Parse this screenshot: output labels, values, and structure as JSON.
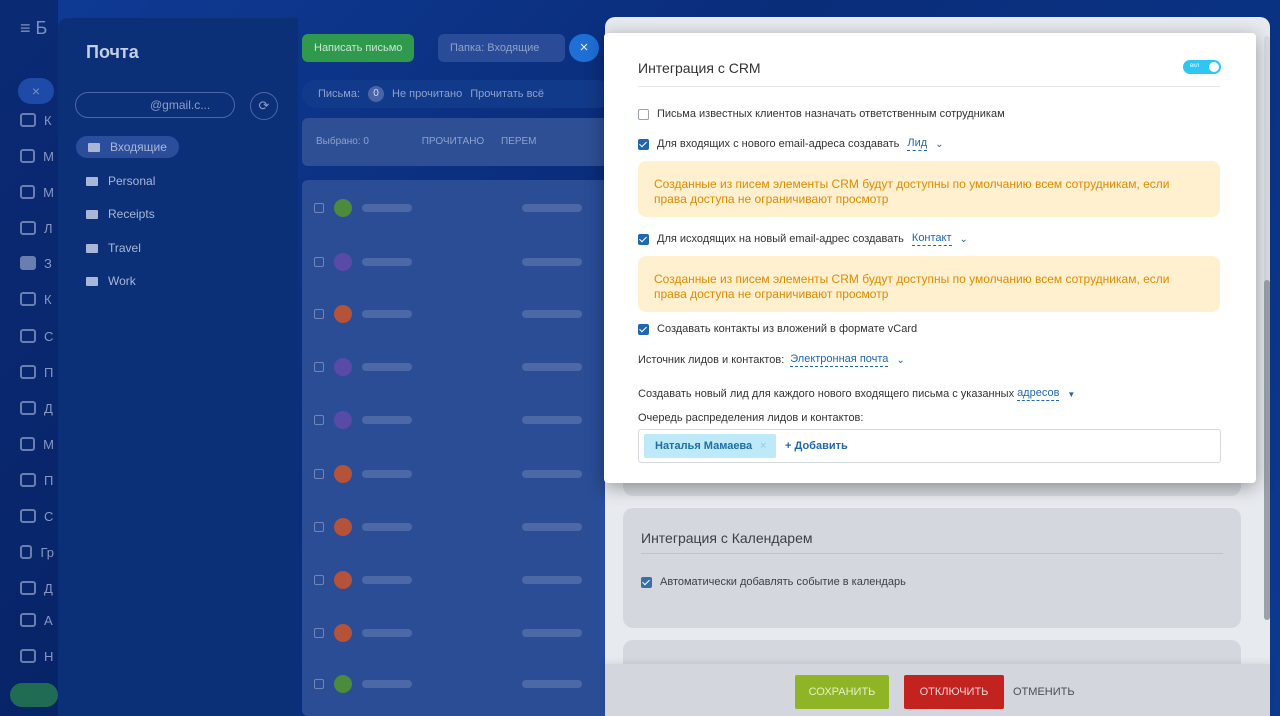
{
  "background_app": {
    "left_nav": [
      "К",
      "М",
      "М",
      "Л",
      "З",
      "К",
      "С",
      "П",
      "Д",
      "М",
      "П",
      "С",
      "Гр",
      "Д",
      "А",
      "Н"
    ],
    "mail_title": "Почта",
    "account": "@gmail.c...",
    "folders": [
      {
        "label": "Входящие"
      },
      {
        "label": "Personal"
      },
      {
        "label": "Receipts"
      },
      {
        "label": "Travel"
      },
      {
        "label": "Work"
      }
    ],
    "compose_label": "Написать письмо",
    "folder_filter": "Папка: Входящие",
    "filter_bar": {
      "letters_label": "Письма:",
      "unread_count": "0",
      "unread_label": "Не прочитано",
      "read_all_label": "Прочитать всё"
    },
    "select_bar": {
      "selected_label": "Выбрано: 0",
      "read_label": "ПРОЧИТАНО",
      "move_label": "ПЕРЕМ"
    }
  },
  "crm": {
    "title": "Интеграция с CRM",
    "toggle_text": "вкл",
    "options": {
      "known_clients": "Письма известных клиентов назначать ответственным сотрудникам",
      "incoming_prefix": "Для входящих с нового email-адреса создавать",
      "incoming_value": "Лид",
      "outgoing_prefix": "Для исходящих на новый email-адрес создавать",
      "outgoing_value": "Контакт",
      "vcard": "Создавать контакты из вложений в формате vCard",
      "source_prefix": "Источник лидов и контактов:",
      "source_value": "Электронная почта",
      "new_lead_prefix": "Создавать новый лид для каждого нового входящего письма с указанных",
      "new_lead_value": "адресов",
      "queue_label": "Очередь распределения лидов и контактов:"
    },
    "alert_text": "Созданные из писем элементы CRM будут доступны по умолчанию всем сотрудникам, если права доступа не ограничивают просмотр",
    "queue_user": "Наталья Мамаева",
    "add_label": "+ Добавить"
  },
  "calendar": {
    "title": "Интеграция с Календарем",
    "auto_add": "Автоматически добавлять событие в календарь"
  },
  "footer": {
    "save": "СОХРАНИТЬ",
    "disable": "ОТКЛЮЧИТЬ",
    "cancel": "ОТМЕНИТЬ"
  },
  "colors": {
    "accent": "#2067b0",
    "toggle": "#2fc6f6",
    "alert_bg": "#fff0cf",
    "alert_text": "#e08b00",
    "save": "#8fb526",
    "disable": "#c3231f"
  }
}
